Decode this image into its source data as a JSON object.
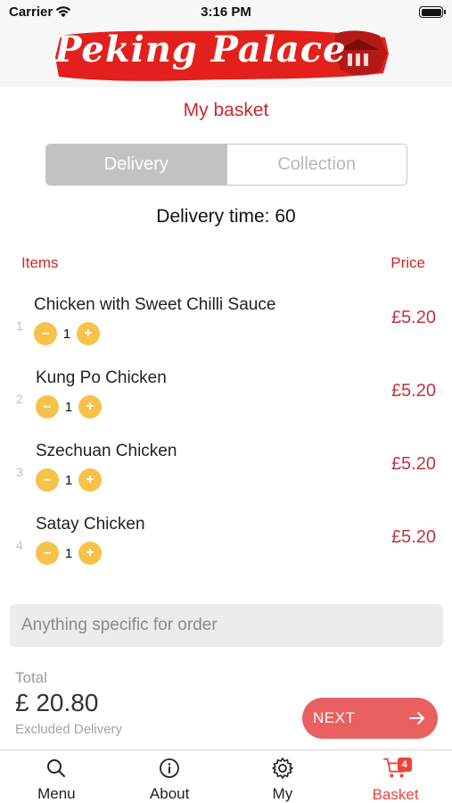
{
  "status_bar": {
    "carrier": "Carrier",
    "time": "3:16 PM"
  },
  "header": {
    "logo_text": "Peking Palace"
  },
  "page": {
    "title": "My basket"
  },
  "delivery_mode": {
    "options": [
      "Delivery",
      "Collection"
    ],
    "selected": "Delivery"
  },
  "delivery_time": "Delivery time: 60",
  "columns": {
    "items": "Items",
    "price": "Price"
  },
  "items": [
    {
      "number": "1",
      "name": "Chicken with Sweet Chilli Sauce",
      "quantity": "1",
      "price": "£5.20"
    },
    {
      "number": "2",
      "name": "Kung Po Chicken",
      "quantity": "1",
      "price": "£5.20"
    },
    {
      "number": "3",
      "name": "Szechuan Chicken",
      "quantity": "1",
      "price": "£5.20"
    },
    {
      "number": "4",
      "name": "Satay Chicken",
      "quantity": "1",
      "price": "£5.20"
    }
  ],
  "note": {
    "placeholder": "Anything specific for order",
    "value": ""
  },
  "summary": {
    "total_label": "Total",
    "total_value": "£ 20.80",
    "note": "Excluded Delivery"
  },
  "next_button": {
    "label": "NEXT",
    "icon": "arrow-right-icon"
  },
  "tabs": [
    {
      "label": "Menu",
      "icon": "search-icon",
      "active": false
    },
    {
      "label": "About",
      "icon": "info-icon",
      "active": false
    },
    {
      "label": "My",
      "icon": "gear-icon",
      "active": false
    },
    {
      "label": "Basket",
      "icon": "cart-icon",
      "active": true,
      "badge": "4"
    }
  ],
  "colors": {
    "accent": "#d0262b",
    "price": "#c0353e",
    "qty_button": "#f6c24a",
    "next_button": "#e86060",
    "tab_active": "#e9453e"
  }
}
